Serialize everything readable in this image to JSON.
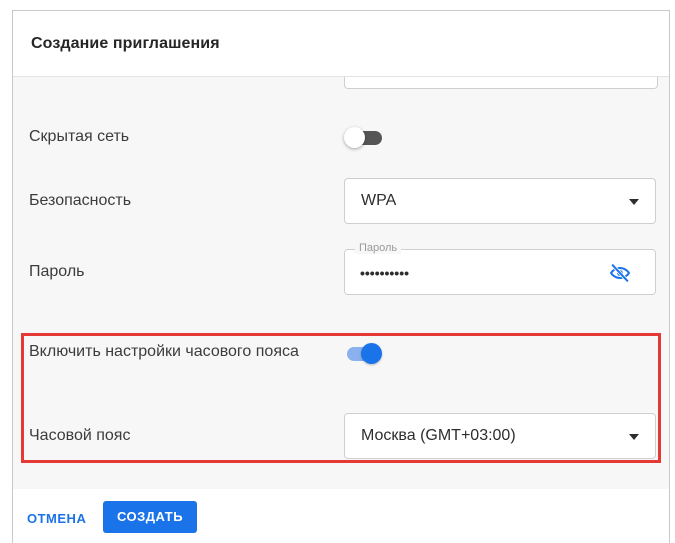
{
  "dialog": {
    "title": "Создание приглашения"
  },
  "fields": {
    "hidden_network": {
      "label": "Скрытая сеть",
      "enabled": false
    },
    "security": {
      "label": "Безопасность",
      "value": "WPA"
    },
    "password": {
      "label": "Пароль",
      "legend": "Пароль",
      "masked_value": "••••••••••",
      "icon": "eye-off-icon"
    },
    "timezone_settings": {
      "label": "Включить настройки часового пояса",
      "enabled": true
    },
    "timezone": {
      "label": "Часовой пояс",
      "value": "Москва (GMT+03:00)"
    }
  },
  "actions": {
    "cancel_label": "ОТМЕНА",
    "create_label": "СОЗДАТЬ"
  },
  "colors": {
    "accent": "#1a73e8",
    "highlight": "#e53935"
  }
}
